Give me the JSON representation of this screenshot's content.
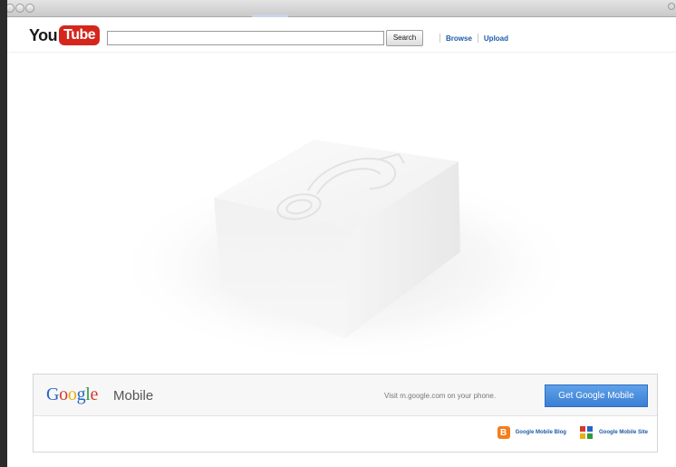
{
  "youtube": {
    "logo": {
      "you": "You",
      "tube": "Tube"
    },
    "search": {
      "value": "",
      "placeholder": "",
      "button_label": "Search"
    },
    "nav": [
      {
        "label": "Browse"
      },
      {
        "label": "Upload"
      }
    ]
  },
  "google_mobile": {
    "logo_text": "Google",
    "product": "Mobile",
    "tagline": "Visit m.google.com on your phone.",
    "cta": "Get Google Mobile",
    "links": [
      {
        "label": "Google Mobile Blog",
        "icon": "blogger-icon"
      },
      {
        "label": "Google Mobile Site",
        "icon": "google-mobile-site-icon"
      }
    ]
  },
  "colors": {
    "youtube_red": "#d4261d",
    "link_blue": "#1d5aa9",
    "cta_blue": "#3b7fd6",
    "blogger_orange": "#f37e1d"
  }
}
